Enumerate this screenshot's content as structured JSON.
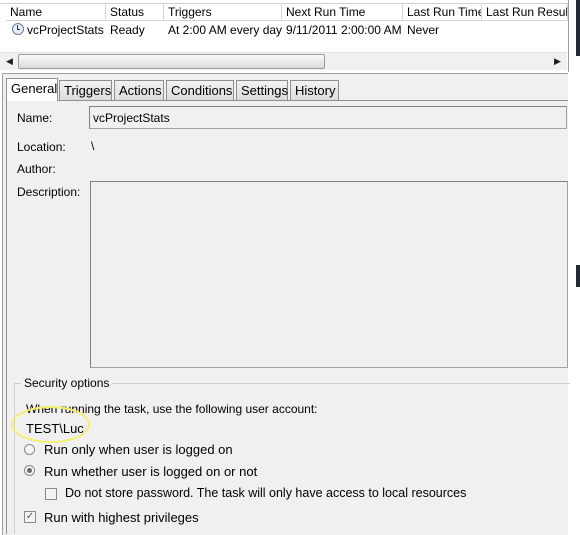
{
  "columns": {
    "name": "Name",
    "status": "Status",
    "triggers": "Triggers",
    "next_run": "Next Run Time",
    "last_run": "Last Run Time",
    "last_result": "Last Run Result"
  },
  "task_row": {
    "name": "vcProjectStats",
    "status": "Ready",
    "triggers": "At 2:00 AM every day",
    "next_run": "9/11/2011 2:00:00 AM",
    "last_run": "Never"
  },
  "tabs": [
    "General",
    "Triggers",
    "Actions",
    "Conditions",
    "Settings",
    "History"
  ],
  "general": {
    "name_label": "Name:",
    "name_value": "vcProjectStats",
    "location_label": "Location:",
    "location_value": "\\",
    "author_label": "Author:",
    "description_label": "Description:"
  },
  "security": {
    "title": "Security options",
    "account_prompt": "When running the task, use the following user account:",
    "account": "TEST\\Luc",
    "radio_logged_on": "Run only when user is logged on",
    "radio_whether": "Run whether user is logged on or not",
    "radio_selected": "Run whether user is logged on or not",
    "no_store_password": "Do not store password.  The task will only have access to local resources",
    "highest_privileges": "Run with highest privileges",
    "highest_privileges_checked": true,
    "no_store_password_checked": false
  },
  "colors": {
    "highlight_circle": "#f5ef6a",
    "panel_bg": "#f0f0f0"
  },
  "icons": {
    "task": "clock-task-icon"
  }
}
